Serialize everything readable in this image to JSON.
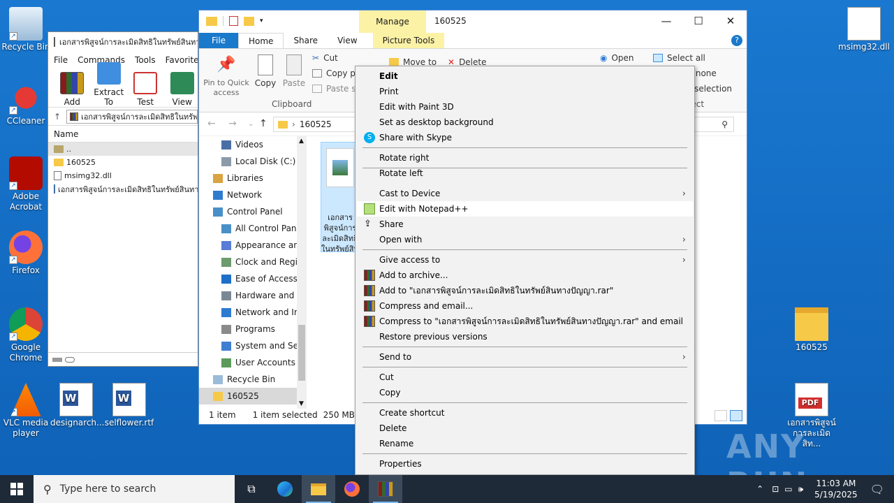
{
  "desktop": {
    "icons_left": [
      {
        "label": "Recycle Bin",
        "icon": "recycle-bin-icon"
      },
      {
        "label": "CCleaner",
        "icon": "ccleaner-icon"
      },
      {
        "label": "Adobe Acrobat",
        "icon": "adobe-acrobat-icon"
      },
      {
        "label": "Firefox",
        "icon": "firefox-icon"
      },
      {
        "label": "Google Chrome",
        "icon": "chrome-icon"
      },
      {
        "label": "VLC media player",
        "icon": "vlc-icon"
      },
      {
        "label": "designarch...",
        "icon": "word-doc-icon"
      },
      {
        "label": "selflower.rtf",
        "icon": "word-doc-icon"
      }
    ],
    "icons_right": [
      {
        "label": "msimg32.dll",
        "icon": "dll-file-icon"
      },
      {
        "label": "160525",
        "icon": "folder-icon"
      },
      {
        "label": "เอกสารพิสูจน์การละเมิดสิท...",
        "icon": "pdf-icon"
      }
    ],
    "watermark": "ANY RUN"
  },
  "winrar": {
    "title": "เอกสารพิสูจน์การละเมิดสิทธิในทรัพย์สินทางปัญญา.rar",
    "menu": [
      "File",
      "Commands",
      "Tools",
      "Favorites"
    ],
    "toolbar": [
      "Add",
      "Extract To",
      "Test",
      "View"
    ],
    "address": "เอกสารพิสูจน์การละเมิดสิทธิในทรัพย์สินทางปัญญา.rar",
    "column": "Name",
    "rows": [
      "..",
      "160525",
      "msimg32.dll",
      "เอกสารพิสูจน์การละเมิดสิทธิในทรัพย์สินทางปัญญา"
    ]
  },
  "explorer": {
    "title": "160525",
    "manage_tab": "Manage",
    "tabs": {
      "file": "File",
      "home": "Home",
      "share": "Share",
      "view": "View",
      "picture_tools": "Picture Tools"
    },
    "ribbon": {
      "pin": "Pin to Quick access",
      "copy": "Copy",
      "paste": "Paste",
      "cut": "Cut",
      "copy_path": "Copy path",
      "paste_shortcut": "Paste shortcut",
      "clipboard_group": "Clipboard",
      "move_to": "Move to",
      "delete": "Delete",
      "open": "Open",
      "select_all": "Select all",
      "select_none": "Select none",
      "invert_selection": "Invert selection",
      "select_group": "Select"
    },
    "path": "160525",
    "nav_items": [
      {
        "label": "Videos",
        "icon": "videos-icon"
      },
      {
        "label": "Local Disk (C:)",
        "icon": "drive-icon"
      },
      {
        "label": "Libraries",
        "icon": "libraries-icon"
      },
      {
        "label": "Network",
        "icon": "network-icon"
      },
      {
        "label": "Control Panel",
        "icon": "control-panel-icon"
      },
      {
        "label": "All Control Panel Items",
        "icon": "control-panel-icon"
      },
      {
        "label": "Appearance and Personalization",
        "icon": "appearance-icon"
      },
      {
        "label": "Clock and Region",
        "icon": "clock-icon"
      },
      {
        "label": "Ease of Access",
        "icon": "ease-of-access-icon"
      },
      {
        "label": "Hardware and Sound",
        "icon": "hardware-icon"
      },
      {
        "label": "Network and Internet",
        "icon": "network-icon"
      },
      {
        "label": "Programs",
        "icon": "programs-icon"
      },
      {
        "label": "System and Security",
        "icon": "security-icon"
      },
      {
        "label": "User Accounts",
        "icon": "user-accounts-icon"
      },
      {
        "label": "Recycle Bin",
        "icon": "recycle-bin-icon"
      },
      {
        "label": "160525",
        "icon": "folder-icon"
      }
    ],
    "file_caption": "เอกสารพิสูจน์การละเมิดสิทธิในทรัพย์สินทางปัญญา",
    "status": {
      "count": "1 item",
      "selected": "1 item selected",
      "size": "250 MB"
    }
  },
  "context_menu": {
    "items": [
      {
        "label": "Edit",
        "bold": true
      },
      {
        "label": "Print"
      },
      {
        "label": "Edit with Paint 3D"
      },
      {
        "label": "Set as desktop background"
      },
      {
        "label": "Share with Skype",
        "icon": "skype-icon"
      },
      {
        "sep": true
      },
      {
        "label": "Rotate right"
      },
      {
        "label": "Rotate left"
      },
      {
        "sep": true
      },
      {
        "label": "Cast to Device",
        "submenu": true
      },
      {
        "label": "Edit with Notepad++",
        "icon": "notepadpp-icon",
        "hover": true
      },
      {
        "label": "Share",
        "icon": "share-icon"
      },
      {
        "label": "Open with",
        "submenu": true
      },
      {
        "sep": true
      },
      {
        "label": "Give access to",
        "submenu": true
      },
      {
        "label": "Add to archive...",
        "icon": "winrar-icon"
      },
      {
        "label": "Add to \"เอกสารพิสูจน์การละเมิดสิทธิในทรัพย์สินทางปัญญา.rar\"",
        "icon": "winrar-icon"
      },
      {
        "label": "Compress and email...",
        "icon": "winrar-icon"
      },
      {
        "label": "Compress to \"เอกสารพิสูจน์การละเมิดสิทธิในทรัพย์สินทางปัญญา.rar\" and email",
        "icon": "winrar-icon"
      },
      {
        "label": "Restore previous versions"
      },
      {
        "sep": true
      },
      {
        "label": "Send to",
        "submenu": true
      },
      {
        "sep": true
      },
      {
        "label": "Cut"
      },
      {
        "label": "Copy"
      },
      {
        "sep": true
      },
      {
        "label": "Create shortcut"
      },
      {
        "label": "Delete"
      },
      {
        "label": "Rename"
      },
      {
        "sep": true
      },
      {
        "label": "Properties"
      }
    ]
  },
  "taskbar": {
    "search_placeholder": "Type here to search",
    "time": "11:03 AM",
    "date": "5/19/2025"
  }
}
